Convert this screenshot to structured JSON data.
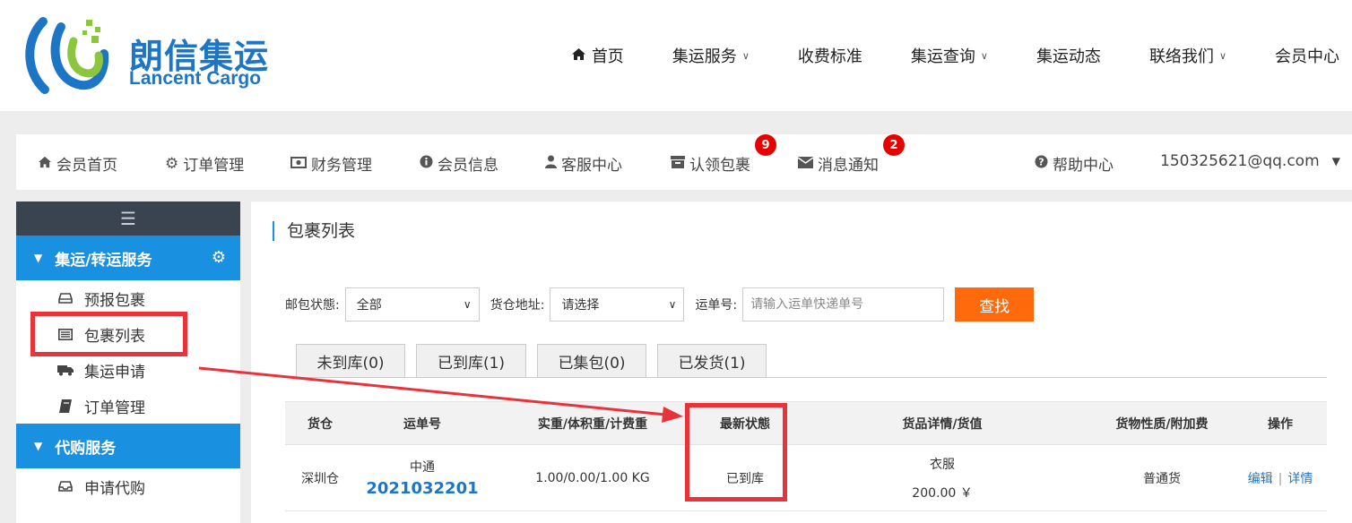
{
  "header": {
    "logo": {
      "cn": "朗信集运",
      "en": "Lancent Cargo",
      "icon": "lancent-logo-mark"
    },
    "nav": [
      {
        "label": "首页",
        "icon": "home-icon",
        "dropdown": false
      },
      {
        "label": "集运服务",
        "dropdown": true
      },
      {
        "label": "收费标准",
        "dropdown": false
      },
      {
        "label": "集运查询",
        "dropdown": true
      },
      {
        "label": "集运动态",
        "dropdown": false
      },
      {
        "label": "联络我们",
        "dropdown": true
      },
      {
        "label": "会员中心",
        "dropdown": false
      }
    ]
  },
  "member_bar": {
    "items": [
      {
        "label": "会员首页",
        "icon": "home-icon"
      },
      {
        "label": "订单管理",
        "icon": "gear-icon"
      },
      {
        "label": "财务管理",
        "icon": "money-icon"
      },
      {
        "label": "会员信息",
        "icon": "info-icon"
      },
      {
        "label": "客服中心",
        "icon": "user-icon"
      },
      {
        "label": "认领包裹",
        "icon": "archive-icon",
        "badge": "9"
      },
      {
        "label": "消息通知",
        "icon": "envelope-icon",
        "badge": "2"
      }
    ],
    "help": {
      "label": "帮助中心",
      "icon": "question-icon"
    },
    "user": {
      "email": "150325621@qq.com"
    }
  },
  "sidebar": {
    "sections": [
      {
        "title": "集运/转运服务",
        "items": [
          {
            "label": "预报包裹",
            "icon": "hdd-icon"
          },
          {
            "label": "包裹列表",
            "icon": "list-icon"
          },
          {
            "label": "集运申请",
            "icon": "truck-icon"
          },
          {
            "label": "订单管理",
            "icon": "book-icon"
          }
        ]
      },
      {
        "title": "代购服务",
        "items": [
          {
            "label": "申请代购",
            "icon": "inbox-icon"
          }
        ]
      }
    ]
  },
  "main": {
    "title": "包裹列表",
    "filters": {
      "status_label": "邮包状態:",
      "status_value": "全部",
      "warehouse_label": "货仓地址:",
      "warehouse_value": "请选择",
      "waybill_label": "运单号:",
      "waybill_placeholder": "请输入运单快递单号",
      "search_button": "查找"
    },
    "tabs": [
      "未到库(0)",
      "已到库(1)",
      "已集包(0)",
      "已发货(1)"
    ],
    "table": {
      "headers": [
        "货仓",
        "运单号",
        "实重/体积重/计费重",
        "最新状態",
        "货品详情/货值",
        "货物性质/附加费",
        "操作"
      ],
      "rows": [
        {
          "warehouse": "深圳仓",
          "carrier": "中通",
          "waybill": "2021032201",
          "weight": "1.00/0.00/1.00 KG",
          "status": "已到库",
          "goods": "衣服",
          "value": "200.00 ￥",
          "nature": "普通货",
          "edit": "编辑",
          "detail": "详情"
        }
      ]
    }
  },
  "colors": {
    "brand_blue": "#1a90e0",
    "sidebar_dark": "#3a4350",
    "search_orange": "#ff6a0c",
    "badge_red": "#e60000",
    "annotation_red": "#e8333b",
    "link_blue": "#1d76c5"
  }
}
